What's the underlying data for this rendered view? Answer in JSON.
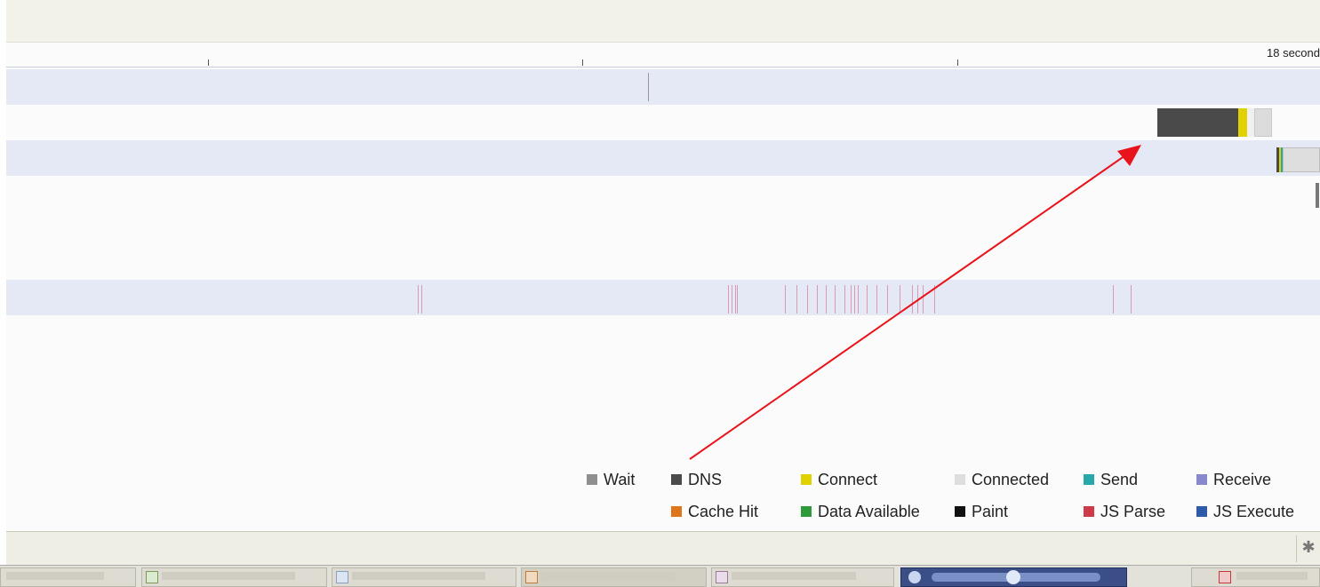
{
  "ruler": {
    "end_label": "18 second"
  },
  "colors": {
    "wait": "#8f8f8f",
    "dns": "#4a4a4a",
    "connect": "#e2d100",
    "connected": "#dedede",
    "send": "#27a9a9",
    "receive": "#8888cc",
    "cache_hit": "#e0761c",
    "data_available": "#2f9a3a",
    "paint": "#111111",
    "js_parse": "#cf3a4a",
    "js_execute": "#2f5aa8",
    "annotation_arrow": "#e8141b"
  },
  "legend": [
    {
      "label": "Wait",
      "color": "#8f8f8f"
    },
    {
      "label": "DNS",
      "color": "#4a4a4a"
    },
    {
      "label": "Connect",
      "color": "#e2d100"
    },
    {
      "label": "Connected",
      "color": "#dedede"
    },
    {
      "label": "Send",
      "color": "#27a9a9"
    },
    {
      "label": "Receive",
      "color": "#8888cc"
    },
    {
      "label": "Cache Hit",
      "color": "#e0761c"
    },
    {
      "label": "Data Available",
      "color": "#2f9a3a"
    },
    {
      "label": "Paint",
      "color": "#111111"
    },
    {
      "label": "JS Parse",
      "color": "#cf3a4a"
    },
    {
      "label": "JS Execute",
      "color": "#2f5aa8"
    }
  ],
  "status_bar": {
    "icon": "firebug-bug-icon"
  },
  "taskbar": {
    "items": [
      "task-1",
      "task-2",
      "task-3",
      "task-4",
      "task-5",
      "task-6",
      "task-7"
    ]
  }
}
